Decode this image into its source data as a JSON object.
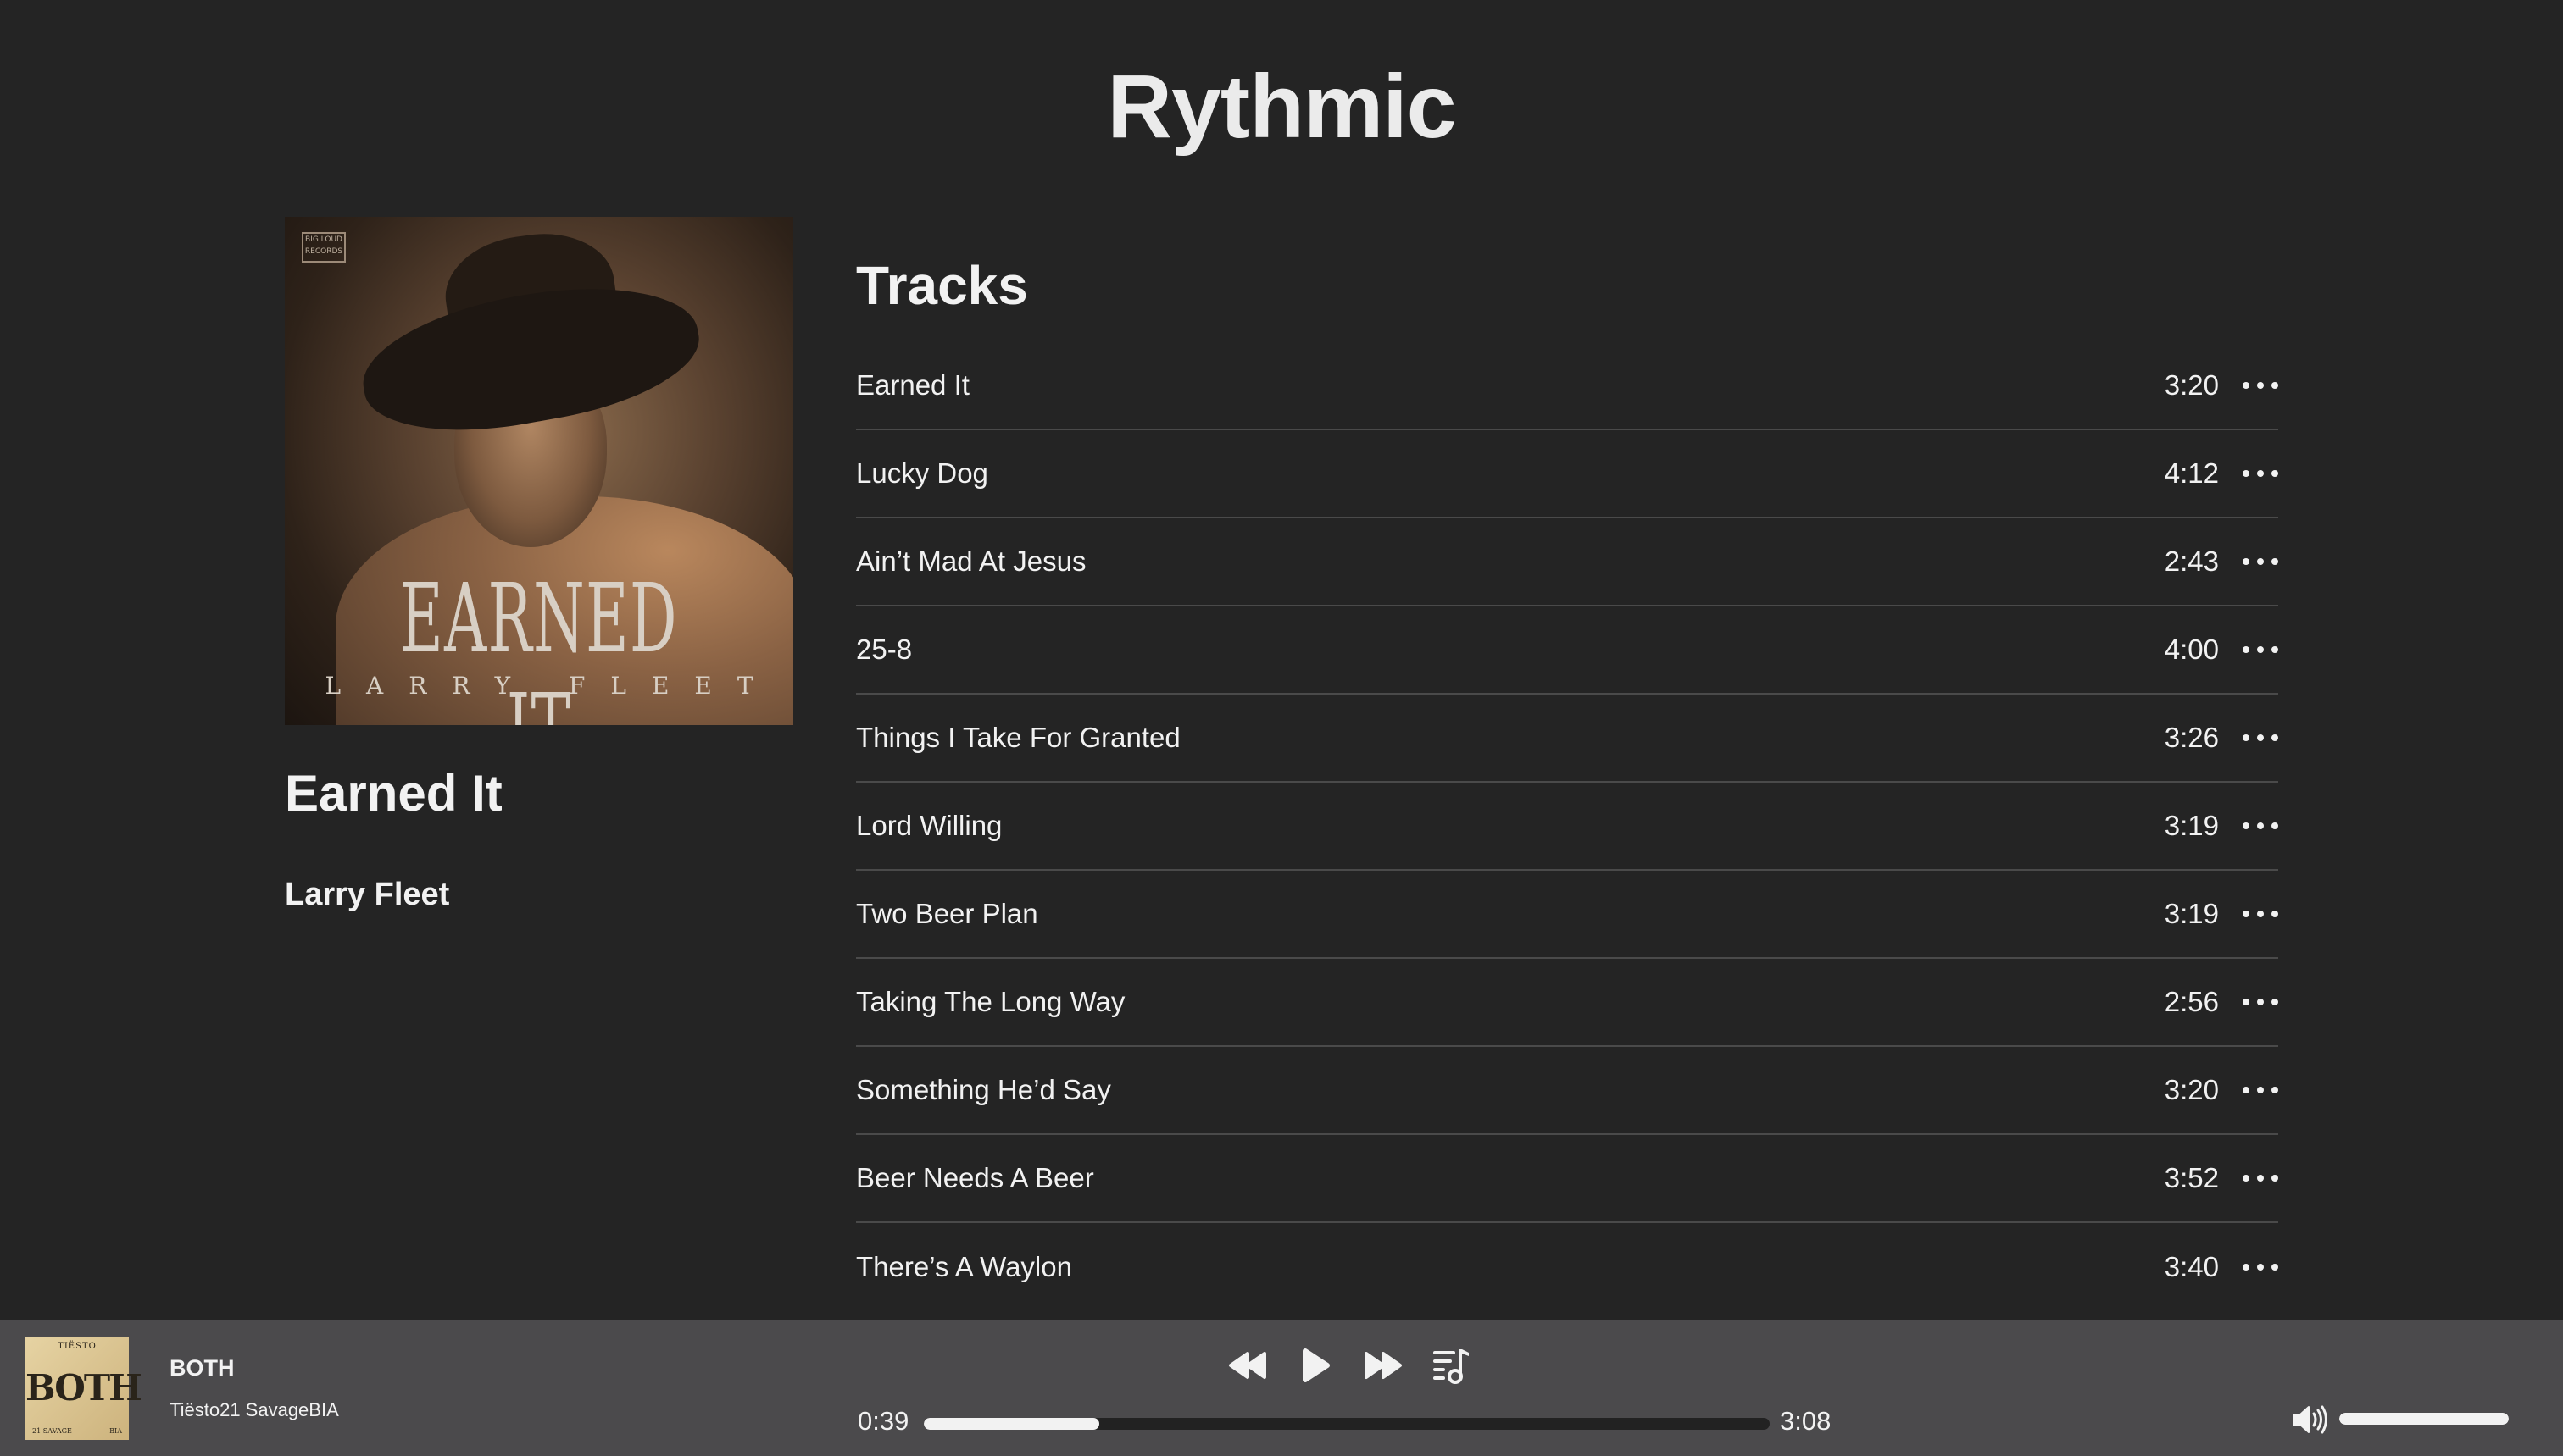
{
  "app": {
    "title": "Rythmic"
  },
  "album": {
    "cover_title": "EARNED IT",
    "cover_artist": "LARRY FLEET",
    "cover_label": "BIG LOUD RECORDS",
    "name": "Earned It",
    "artist": "Larry Fleet"
  },
  "tracks": {
    "heading": "Tracks",
    "items": [
      {
        "name": "Earned It",
        "duration": "3:20"
      },
      {
        "name": "Lucky Dog",
        "duration": "4:12"
      },
      {
        "name": "Ain’t Mad At Jesus",
        "duration": "2:43"
      },
      {
        "name": "25-8",
        "duration": "4:00"
      },
      {
        "name": "Things I Take For Granted",
        "duration": "3:26"
      },
      {
        "name": "Lord Willing",
        "duration": "3:19"
      },
      {
        "name": "Two Beer Plan",
        "duration": "3:19"
      },
      {
        "name": "Taking The Long Way",
        "duration": "2:56"
      },
      {
        "name": "Something He’d Say",
        "duration": "3:20"
      },
      {
        "name": "Beer Needs A Beer",
        "duration": "3:52"
      },
      {
        "name": "There’s A Waylon",
        "duration": "3:40"
      }
    ]
  },
  "player": {
    "art_text": {
      "top": "TIËSTO",
      "title": "BOTH",
      "left": "21 SAVAGE",
      "right": "BIA"
    },
    "title": "BOTH",
    "artist": "Tiësto21 SavageBIA",
    "current_time": "0:39",
    "total_time": "3:08",
    "progress_fraction": 0.207,
    "volume_fraction": 1.0,
    "icons": [
      "rewind-icon",
      "play-icon",
      "fast-forward-icon",
      "queue-icon",
      "volume-icon",
      "more-icon"
    ]
  },
  "colors": {
    "background": "#242424",
    "player_bar": "#4b4a4c",
    "text": "#f2f2f2",
    "divider": "#4a4a4a"
  }
}
